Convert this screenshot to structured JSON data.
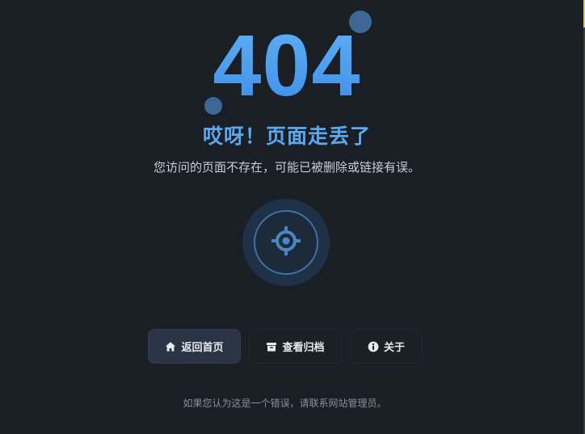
{
  "error": {
    "code": "404",
    "title": "哎呀！页面走丢了",
    "message": "您访问的页面不存在，可能已被删除或链接有误。"
  },
  "buttons": {
    "home_label": "返回首页",
    "archive_label": "查看归档",
    "about_label": "关于"
  },
  "footer": {
    "note": "如果您认为这是一个错误，请联系网站管理员。"
  },
  "icons": {
    "illustration": "crosshair-icon",
    "home": "home-icon",
    "archive": "archive-icon",
    "about": "info-icon"
  },
  "colors": {
    "background": "#1a1e25",
    "accent": "#4aa0f0",
    "title": "#5aa8ee",
    "button_primary_bg": "#2a3444"
  }
}
